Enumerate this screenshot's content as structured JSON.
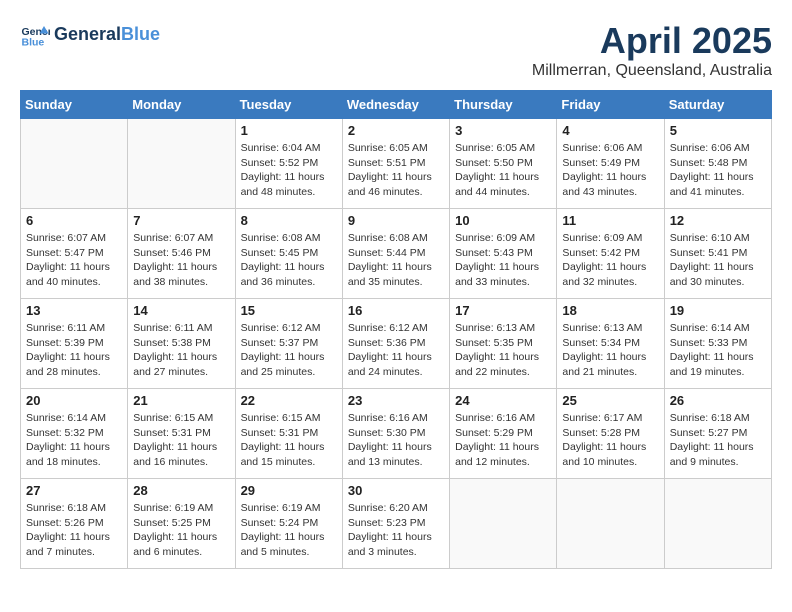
{
  "header": {
    "logo_line1": "General",
    "logo_line2": "Blue",
    "month_title": "April 2025",
    "subtitle": "Millmerran, Queensland, Australia"
  },
  "days_of_week": [
    "Sunday",
    "Monday",
    "Tuesday",
    "Wednesday",
    "Thursday",
    "Friday",
    "Saturday"
  ],
  "weeks": [
    [
      {
        "day": "",
        "info": ""
      },
      {
        "day": "",
        "info": ""
      },
      {
        "day": "1",
        "info": "Sunrise: 6:04 AM\nSunset: 5:52 PM\nDaylight: 11 hours and 48 minutes."
      },
      {
        "day": "2",
        "info": "Sunrise: 6:05 AM\nSunset: 5:51 PM\nDaylight: 11 hours and 46 minutes."
      },
      {
        "day": "3",
        "info": "Sunrise: 6:05 AM\nSunset: 5:50 PM\nDaylight: 11 hours and 44 minutes."
      },
      {
        "day": "4",
        "info": "Sunrise: 6:06 AM\nSunset: 5:49 PM\nDaylight: 11 hours and 43 minutes."
      },
      {
        "day": "5",
        "info": "Sunrise: 6:06 AM\nSunset: 5:48 PM\nDaylight: 11 hours and 41 minutes."
      }
    ],
    [
      {
        "day": "6",
        "info": "Sunrise: 6:07 AM\nSunset: 5:47 PM\nDaylight: 11 hours and 40 minutes."
      },
      {
        "day": "7",
        "info": "Sunrise: 6:07 AM\nSunset: 5:46 PM\nDaylight: 11 hours and 38 minutes."
      },
      {
        "day": "8",
        "info": "Sunrise: 6:08 AM\nSunset: 5:45 PM\nDaylight: 11 hours and 36 minutes."
      },
      {
        "day": "9",
        "info": "Sunrise: 6:08 AM\nSunset: 5:44 PM\nDaylight: 11 hours and 35 minutes."
      },
      {
        "day": "10",
        "info": "Sunrise: 6:09 AM\nSunset: 5:43 PM\nDaylight: 11 hours and 33 minutes."
      },
      {
        "day": "11",
        "info": "Sunrise: 6:09 AM\nSunset: 5:42 PM\nDaylight: 11 hours and 32 minutes."
      },
      {
        "day": "12",
        "info": "Sunrise: 6:10 AM\nSunset: 5:41 PM\nDaylight: 11 hours and 30 minutes."
      }
    ],
    [
      {
        "day": "13",
        "info": "Sunrise: 6:11 AM\nSunset: 5:39 PM\nDaylight: 11 hours and 28 minutes."
      },
      {
        "day": "14",
        "info": "Sunrise: 6:11 AM\nSunset: 5:38 PM\nDaylight: 11 hours and 27 minutes."
      },
      {
        "day": "15",
        "info": "Sunrise: 6:12 AM\nSunset: 5:37 PM\nDaylight: 11 hours and 25 minutes."
      },
      {
        "day": "16",
        "info": "Sunrise: 6:12 AM\nSunset: 5:36 PM\nDaylight: 11 hours and 24 minutes."
      },
      {
        "day": "17",
        "info": "Sunrise: 6:13 AM\nSunset: 5:35 PM\nDaylight: 11 hours and 22 minutes."
      },
      {
        "day": "18",
        "info": "Sunrise: 6:13 AM\nSunset: 5:34 PM\nDaylight: 11 hours and 21 minutes."
      },
      {
        "day": "19",
        "info": "Sunrise: 6:14 AM\nSunset: 5:33 PM\nDaylight: 11 hours and 19 minutes."
      }
    ],
    [
      {
        "day": "20",
        "info": "Sunrise: 6:14 AM\nSunset: 5:32 PM\nDaylight: 11 hours and 18 minutes."
      },
      {
        "day": "21",
        "info": "Sunrise: 6:15 AM\nSunset: 5:31 PM\nDaylight: 11 hours and 16 minutes."
      },
      {
        "day": "22",
        "info": "Sunrise: 6:15 AM\nSunset: 5:31 PM\nDaylight: 11 hours and 15 minutes."
      },
      {
        "day": "23",
        "info": "Sunrise: 6:16 AM\nSunset: 5:30 PM\nDaylight: 11 hours and 13 minutes."
      },
      {
        "day": "24",
        "info": "Sunrise: 6:16 AM\nSunset: 5:29 PM\nDaylight: 11 hours and 12 minutes."
      },
      {
        "day": "25",
        "info": "Sunrise: 6:17 AM\nSunset: 5:28 PM\nDaylight: 11 hours and 10 minutes."
      },
      {
        "day": "26",
        "info": "Sunrise: 6:18 AM\nSunset: 5:27 PM\nDaylight: 11 hours and 9 minutes."
      }
    ],
    [
      {
        "day": "27",
        "info": "Sunrise: 6:18 AM\nSunset: 5:26 PM\nDaylight: 11 hours and 7 minutes."
      },
      {
        "day": "28",
        "info": "Sunrise: 6:19 AM\nSunset: 5:25 PM\nDaylight: 11 hours and 6 minutes."
      },
      {
        "day": "29",
        "info": "Sunrise: 6:19 AM\nSunset: 5:24 PM\nDaylight: 11 hours and 5 minutes."
      },
      {
        "day": "30",
        "info": "Sunrise: 6:20 AM\nSunset: 5:23 PM\nDaylight: 11 hours and 3 minutes."
      },
      {
        "day": "",
        "info": ""
      },
      {
        "day": "",
        "info": ""
      },
      {
        "day": "",
        "info": ""
      }
    ]
  ]
}
